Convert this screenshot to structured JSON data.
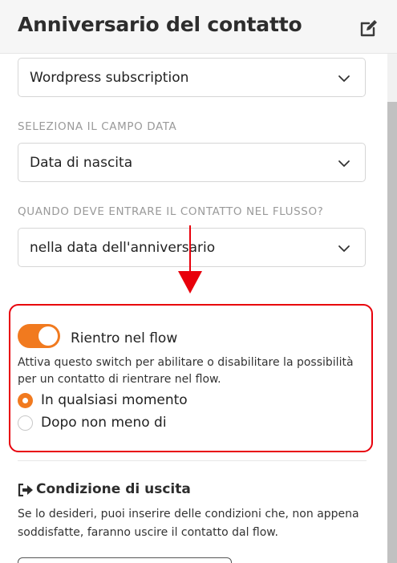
{
  "header": {
    "title": "Anniversario del contatto",
    "edit_icon": "pencil-square-icon"
  },
  "fields": {
    "subscription_select": {
      "value": "Wordpress subscription"
    },
    "date_field": {
      "label": "SELEZIONA IL CAMPO DATA",
      "value": "Data di nascita"
    },
    "entry_when": {
      "label": "QUANDO DEVE ENTRARE IL CONTATTO NEL FLUSSO?",
      "value": "nella data dell'anniversario"
    }
  },
  "reentry": {
    "toggle_label": "Rientro nel flow",
    "toggle_on": true,
    "help_text": "Attiva questo switch per abilitare o disabilitare la possibilità per un contatto di rientrare nel flow.",
    "options": [
      {
        "label": "In qualsiasi momento",
        "checked": true
      },
      {
        "label": "Dopo non meno di",
        "checked": false
      }
    ]
  },
  "exit_condition": {
    "icon": "sign-out-icon",
    "title": "Condizione di uscita",
    "description": "Se lo desideri, puoi inserire delle condizioni che, non appena soddisfatte, faranno uscire il contatto dal flow."
  },
  "colors": {
    "accent": "#f17a1f",
    "annotation": "#e8000b"
  }
}
